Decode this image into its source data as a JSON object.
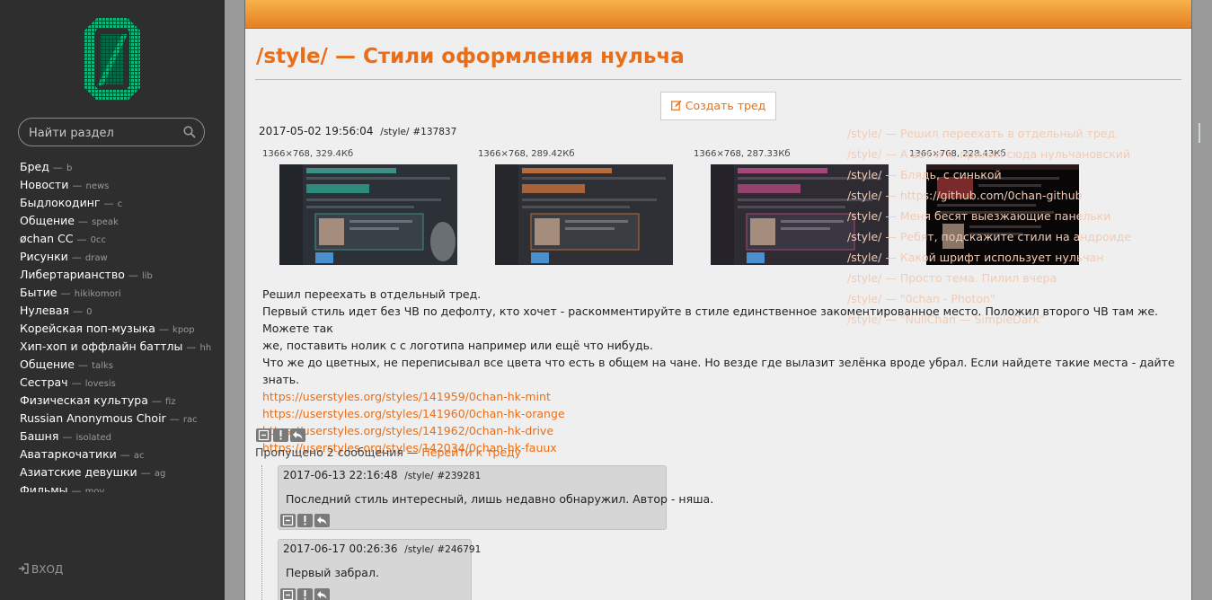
{
  "sidebar": {
    "search_placeholder": "Найти раздел",
    "boards": [
      {
        "title": "Бред",
        "code": "b"
      },
      {
        "title": "Новости",
        "code": "news"
      },
      {
        "title": "Быдлокодинг",
        "code": "c"
      },
      {
        "title": "Общение",
        "code": "speak"
      },
      {
        "title": "øchan CC",
        "code": "0cc"
      },
      {
        "title": "Рисунки",
        "code": "draw"
      },
      {
        "title": "Либертарианство",
        "code": "lib"
      },
      {
        "title": "Бытие",
        "code": "hikikomori"
      },
      {
        "title": "Нулевая",
        "code": "0"
      },
      {
        "title": "Корейская поп-музыка",
        "code": "kpop"
      },
      {
        "title": "Хип-хоп и оффлайн баттлы",
        "code": "hh"
      },
      {
        "title": "Общение",
        "code": "talks"
      },
      {
        "title": "Сестрач",
        "code": "lovesis"
      },
      {
        "title": "Физическая культура",
        "code": "fiz"
      },
      {
        "title": "Russian Anonymous Choir",
        "code": "rac"
      },
      {
        "title": "Башня",
        "code": "isolated"
      },
      {
        "title": "Аватаркочатики",
        "code": "ac"
      },
      {
        "title": "Азиатские девушки",
        "code": "ag"
      },
      {
        "title": "Фильмы",
        "code": "mov"
      }
    ],
    "separator": "—",
    "login_label": "ВХОД",
    "colors": {
      "background": "#2e2e2e",
      "logo": "#10b27a"
    }
  },
  "main": {
    "board_title": "/style/ — Стили оформления нульча",
    "create_thread_label": "Создать тред",
    "accent_color": "#ea6e17",
    "op": {
      "date": "2017-05-02 19:56:04",
      "board": "/style/",
      "number": "#137837",
      "images": [
        {
          "info": "1366×768, 329.4Кб",
          "theme": "mint"
        },
        {
          "info": "1366×768, 289.42Кб",
          "theme": "orange"
        },
        {
          "info": "1366×768, 287.33Кб",
          "theme": "drive"
        },
        {
          "info": "1366×768, 228.43Кб",
          "theme": "fauux"
        }
      ],
      "lines": [
        "Решил переехать в отдельный тред.",
        "Первый стиль идет без ЧВ по дефолту, кто хочет - раскомментируйте в стиле единственное закоментированное место. Положил второго ЧВ там же. Можете так",
        "же, поставить нолик с с логотипа например или ещё что нибудь.",
        "Что же до цветных, не переписывал все цвета что есть в общем на чане. Но везде где вылазит зелёнка вроде убрал. Если найдете такие места - дайте знать."
      ],
      "links": [
        "https://userstyles.org/styles/141959/0chan-hk-mint",
        "https://userstyles.org/styles/141960/0chan-hk-orange",
        "https://userstyles.org/styles/141962/0chan-hk-drive",
        "https://userstyles.org/styles/142034/0chan-hk-fauux"
      ]
    },
    "omitted_text": "Пропущено 2 сообщения —",
    "go_to_thread_label": "Перейти к треду",
    "replies": [
      {
        "date": "2017-06-13 22:16:48",
        "board": "/style/",
        "number": "#239281",
        "text": "Последний стиль интересный, лишь недавно обнаружил. Автор - няша."
      },
      {
        "date": "2017-06-17 00:26:36",
        "board": "/style/",
        "number": "#246791",
        "text": "Первый забрал."
      }
    ],
    "overlay_threads": [
      "/style/ — Решил переехать в отдельный тред.",
      "/style/ — А вот и я, прилил сюда нульчановский",
      "/style/ — Блядь, с синькой",
      "/style/ — https://github.com/0chan-github",
      "/style/ — Меня бесят выезжающие панельки",
      "/style/ — Ребят, подскажите стили на андроиде",
      "/style/ — Какой шрифт использует нульчан",
      "/style/ — Просто тема. Пилил вчера",
      "/style/ — \"0chan - Photon\"",
      "/style/ — \"NullChan — SimpleDark\""
    ]
  }
}
